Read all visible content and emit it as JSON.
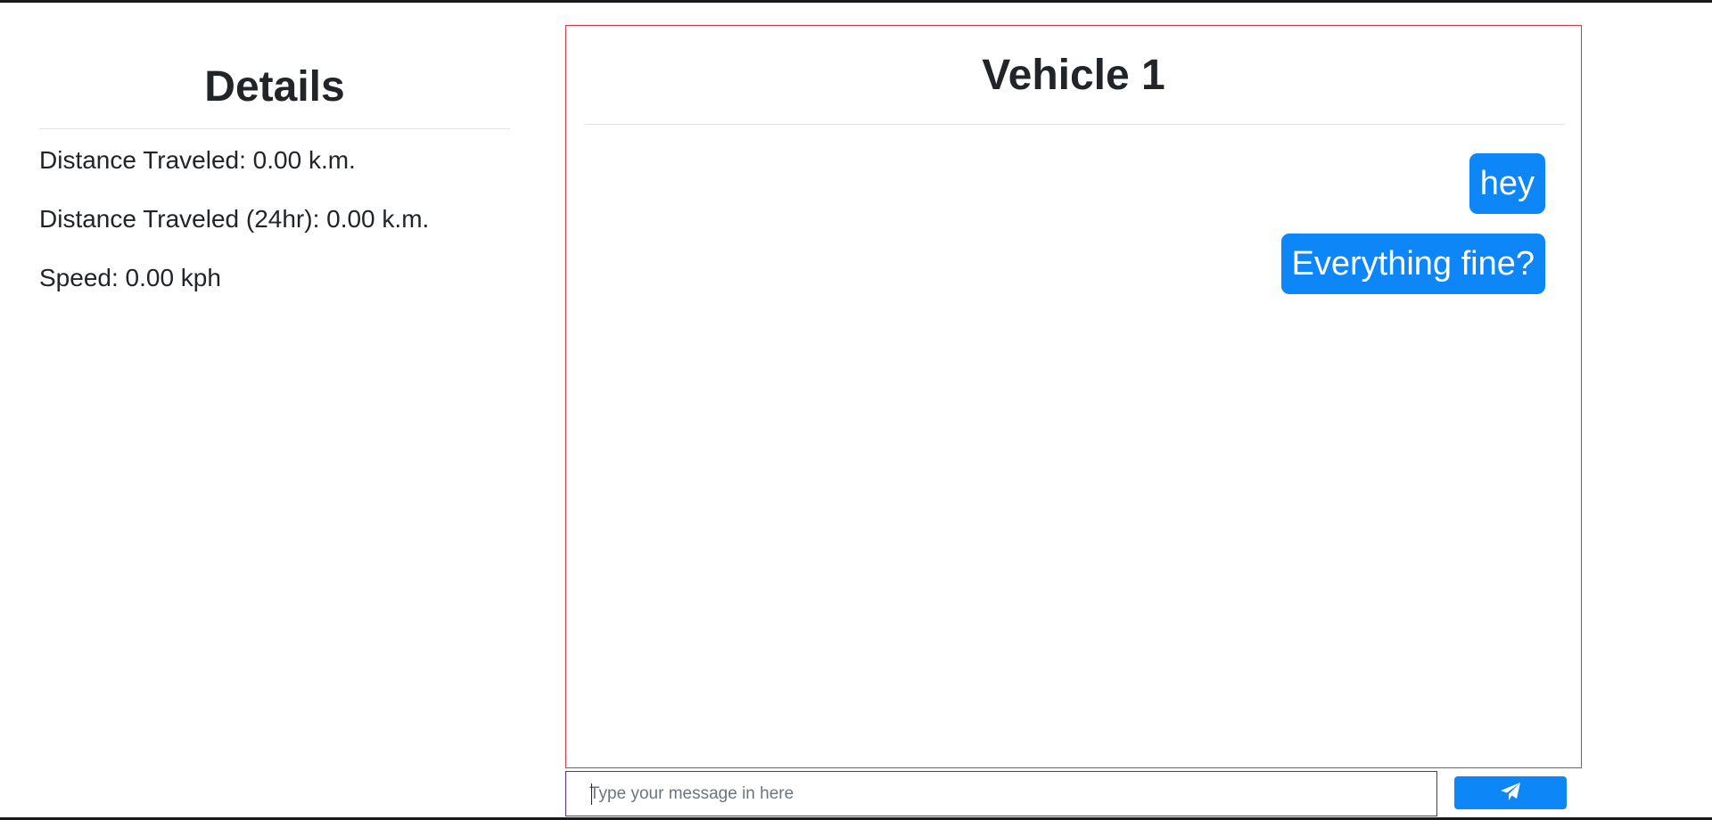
{
  "details": {
    "title": "Details",
    "rows": [
      "Distance Traveled: 0.00 k.m.",
      "Distance Traveled (24hr): 0.00 k.m.",
      "Speed: 0.00 kph"
    ]
  },
  "chat": {
    "title": "Vehicle 1",
    "messages": [
      "hey",
      "Everything fine?"
    ]
  },
  "composer": {
    "placeholder": "Type your message in here",
    "value": "",
    "send_icon": "paper-plane-icon"
  },
  "colors": {
    "bubble": "#0d86f7",
    "chat_border": "#dc3545",
    "input_border": "#5a2d91",
    "send_button": "#0d86f7"
  }
}
